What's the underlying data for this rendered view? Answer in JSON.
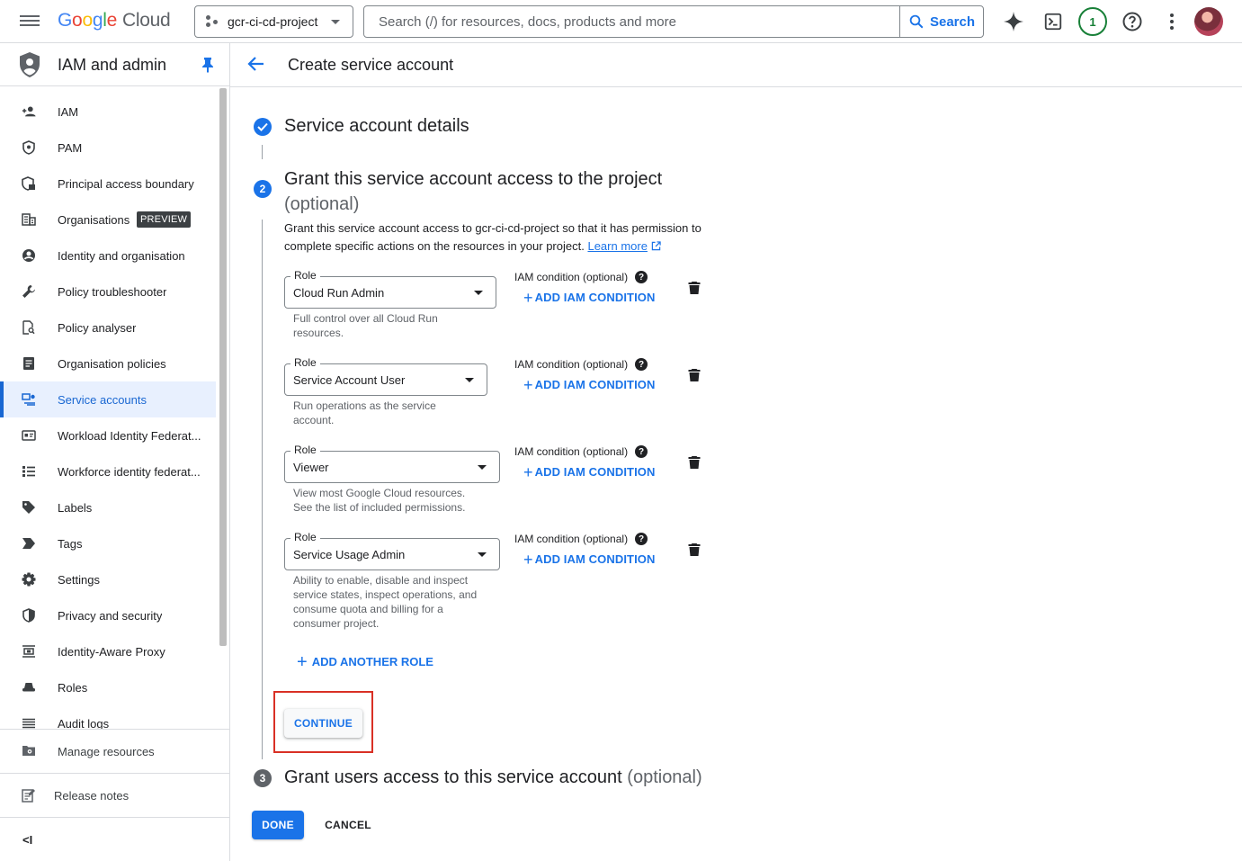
{
  "topbar": {
    "project_name": "gcr-ci-cd-project",
    "search_placeholder": "Search (/) for resources, docs, products and more",
    "search_button": "Search",
    "notification_count": "1",
    "accent_color": "#1a73e8"
  },
  "sidebar": {
    "product_title": "IAM and admin",
    "items": [
      {
        "label": "IAM",
        "icon": "person-add-icon"
      },
      {
        "label": "PAM",
        "icon": "shield-icon"
      },
      {
        "label": "Principal access boundary",
        "icon": "shield-lock-icon"
      },
      {
        "label": "Organisations",
        "icon": "building-icon",
        "badge": "PREVIEW"
      },
      {
        "label": "Identity and organisation",
        "icon": "account-circle-icon"
      },
      {
        "label": "Policy troubleshooter",
        "icon": "wrench-icon"
      },
      {
        "label": "Policy analyser",
        "icon": "document-search-icon"
      },
      {
        "label": "Organisation policies",
        "icon": "document-list-icon"
      },
      {
        "label": "Service accounts",
        "icon": "service-account-icon",
        "active": true
      },
      {
        "label": "Workload Identity Federat...",
        "icon": "badge-card-icon"
      },
      {
        "label": "Workforce identity federat...",
        "icon": "list-icon"
      },
      {
        "label": "Labels",
        "icon": "label-tag-icon"
      },
      {
        "label": "Tags",
        "icon": "tag-arrow-icon"
      },
      {
        "label": "Settings",
        "icon": "gear-icon"
      },
      {
        "label": "Privacy and security",
        "icon": "privacy-shield-icon"
      },
      {
        "label": "Identity-Aware Proxy",
        "icon": "proxy-icon"
      },
      {
        "label": "Roles",
        "icon": "hat-icon"
      },
      {
        "label": "Audit logs",
        "icon": "lines-icon"
      }
    ],
    "manage_resources": "Manage resources",
    "release_notes": "Release notes",
    "collapse_label": "<I"
  },
  "main": {
    "page_title": "Create service account",
    "step1": {
      "title": "Service account details"
    },
    "step2": {
      "number": "2",
      "title": "Grant this service account access to the project",
      "optional": "(optional)",
      "description": "Grant this service account access to gcr-ci-cd-project so that it has permission to complete specific actions on the resources in your project.",
      "learn_more": "Learn more"
    },
    "roles": [
      {
        "legend": "Role",
        "value": "Cloud Run Admin",
        "helper": "Full control over all Cloud Run resources."
      },
      {
        "legend": "Role",
        "value": "Service Account User",
        "helper": "Run operations as the service account."
      },
      {
        "legend": "Role",
        "value": "Viewer",
        "helper": "View most Google Cloud resources. See the list of included permissions."
      },
      {
        "legend": "Role",
        "value": "Service Usage Admin",
        "helper": "Ability to enable, disable and inspect service states, inspect operations, and consume quota and billing for a consumer project."
      }
    ],
    "condition_label": "IAM condition (optional)",
    "add_condition": "ADD IAM CONDITION",
    "add_another_role": "ADD ANOTHER ROLE",
    "continue": "CONTINUE",
    "step3": {
      "number": "3",
      "title": "Grant users access to this service account",
      "optional": "(optional)"
    },
    "done": "DONE",
    "cancel": "CANCEL"
  }
}
